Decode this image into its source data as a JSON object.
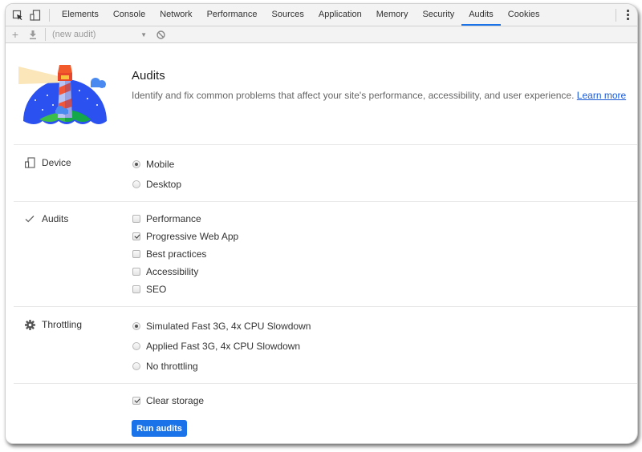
{
  "tabbar": {
    "icons": [
      "inspect-element-icon",
      "device-toolbar-icon"
    ],
    "tabs": [
      {
        "label": "Elements",
        "active": false
      },
      {
        "label": "Console",
        "active": false
      },
      {
        "label": "Network",
        "active": false
      },
      {
        "label": "Performance",
        "active": false
      },
      {
        "label": "Sources",
        "active": false
      },
      {
        "label": "Application",
        "active": false
      },
      {
        "label": "Memory",
        "active": false
      },
      {
        "label": "Security",
        "active": false
      },
      {
        "label": "Audits",
        "active": true
      },
      {
        "label": "Cookies",
        "active": false
      }
    ],
    "menu_icon": "kebab-menu-icon"
  },
  "toolbar": {
    "add_icon": "plus-icon",
    "download_icon": "download-icon",
    "audit_select_value": "(new audit)",
    "clear_icon": "block-icon"
  },
  "header": {
    "title": "Audits",
    "description": "Identify and fix common problems that affect your site's performance, accessibility, and user experience.",
    "learn_more": "Learn more"
  },
  "device": {
    "label": "Device",
    "icon": "device-icon",
    "options": [
      {
        "label": "Mobile",
        "selected": true
      },
      {
        "label": "Desktop",
        "selected": false
      }
    ]
  },
  "audits": {
    "label": "Audits",
    "icon": "checkmark-icon",
    "options": [
      {
        "label": "Performance",
        "checked": false
      },
      {
        "label": "Progressive Web App",
        "checked": true
      },
      {
        "label": "Best practices",
        "checked": false
      },
      {
        "label": "Accessibility",
        "checked": false
      },
      {
        "label": "SEO",
        "checked": false
      }
    ]
  },
  "throttling": {
    "label": "Throttling",
    "icon": "gear-icon",
    "options": [
      {
        "label": "Simulated Fast 3G, 4x CPU Slowdown",
        "selected": true
      },
      {
        "label": "Applied Fast 3G, 4x CPU Slowdown",
        "selected": false
      },
      {
        "label": "No throttling",
        "selected": false
      }
    ]
  },
  "clear_storage": {
    "label": "Clear storage",
    "checked": true
  },
  "run_button": {
    "label": "Run audits"
  },
  "colors": {
    "accent": "#1a73e8",
    "link": "#1a5ad6"
  }
}
